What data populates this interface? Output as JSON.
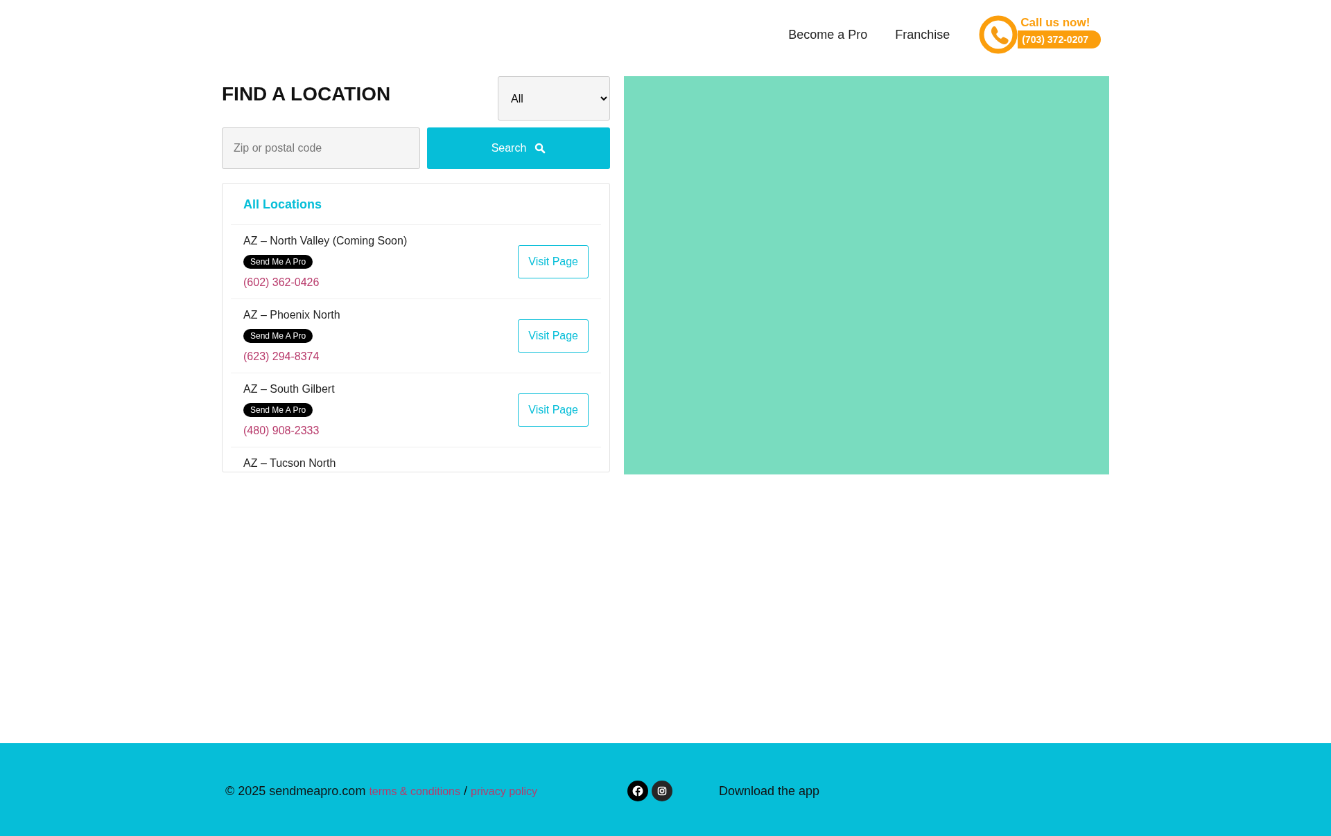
{
  "nav": [
    {
      "label": "Become a Pro"
    },
    {
      "label": "Franchise"
    }
  ],
  "call": {
    "heading": "Call us now!",
    "phone": "(703) 372-0207"
  },
  "finder": {
    "title": "FIND A LOCATION",
    "filter": {
      "value": "All"
    },
    "search_field": {
      "placeholder": "Zip or postal code"
    },
    "search_button": "Search"
  },
  "locations": {
    "heading": "All Locations",
    "rows": [
      {
        "name": "AZ – North Valley (Coming Soon)",
        "badge": "Send Me A Pro",
        "phone": "(602) 362-0426",
        "button": "Visit Page"
      },
      {
        "name": "AZ – Phoenix North",
        "badge": "Send Me A Pro",
        "phone": "(623) 294-8374",
        "button": "Visit Page"
      },
      {
        "name": "AZ – South Gilbert",
        "badge": "Send Me A Pro",
        "phone": "(480) 908-2333",
        "button": "Visit Page"
      },
      {
        "name": "AZ – Tucson North"
      }
    ]
  },
  "footer": {
    "copyright": "© 2025 sendmeapro.com",
    "links": [
      {
        "label": "terms & conditions"
      },
      {
        "label": "privacy policy"
      }
    ],
    "separator": "/",
    "app_text": "Download the app"
  }
}
